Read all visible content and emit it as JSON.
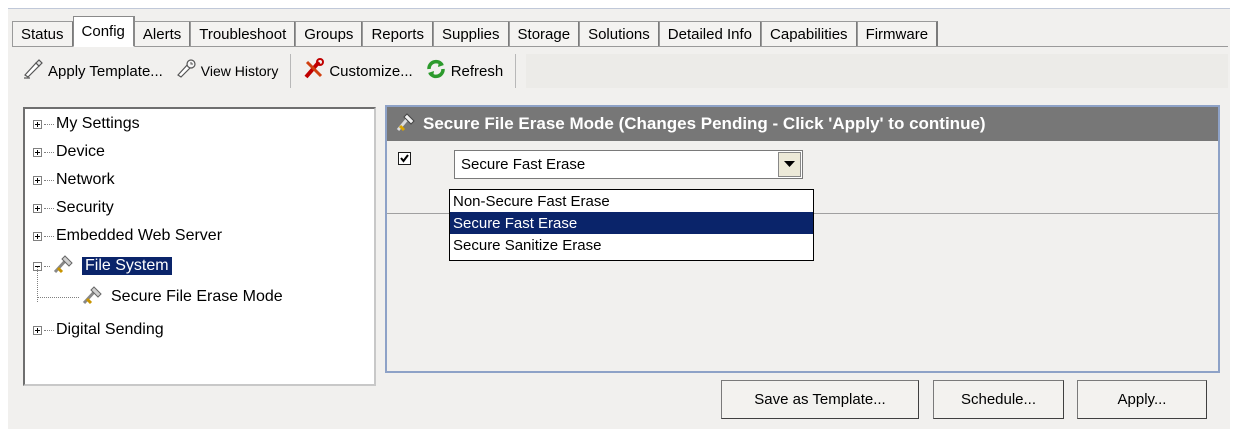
{
  "tabs": [
    "Status",
    "Config",
    "Alerts",
    "Troubleshoot",
    "Groups",
    "Reports",
    "Supplies",
    "Storage",
    "Solutions",
    "Detailed Info",
    "Capabilities",
    "Firmware"
  ],
  "active_tab": "Config",
  "toolbar": {
    "apply_template": "Apply Template...",
    "view_history": "View History",
    "customize": "Customize...",
    "refresh": "Refresh"
  },
  "tree": {
    "my_settings": "My Settings",
    "device": "Device",
    "network": "Network",
    "security": "Security",
    "embedded_web_server": "Embedded Web Server",
    "file_system": "File System",
    "secure_file_erase_mode": "Secure File Erase Mode",
    "digital_sending": "Digital Sending"
  },
  "content": {
    "header": "Secure File Erase Mode (Changes Pending - Click 'Apply' to continue)",
    "checkbox_checked": true,
    "combo_value": "Secure Fast Erase",
    "options": [
      "Non-Secure Fast Erase",
      "Secure Fast Erase",
      "Secure Sanitize Erase"
    ],
    "highlighted_option": "Secure Fast Erase"
  },
  "buttons": {
    "save_as_template": "Save as Template...",
    "schedule": "Schedule...",
    "apply": "Apply..."
  },
  "colors": {
    "selection": "#0a246a",
    "header_bg": "#777777",
    "content_border": "#8ea2c7"
  }
}
